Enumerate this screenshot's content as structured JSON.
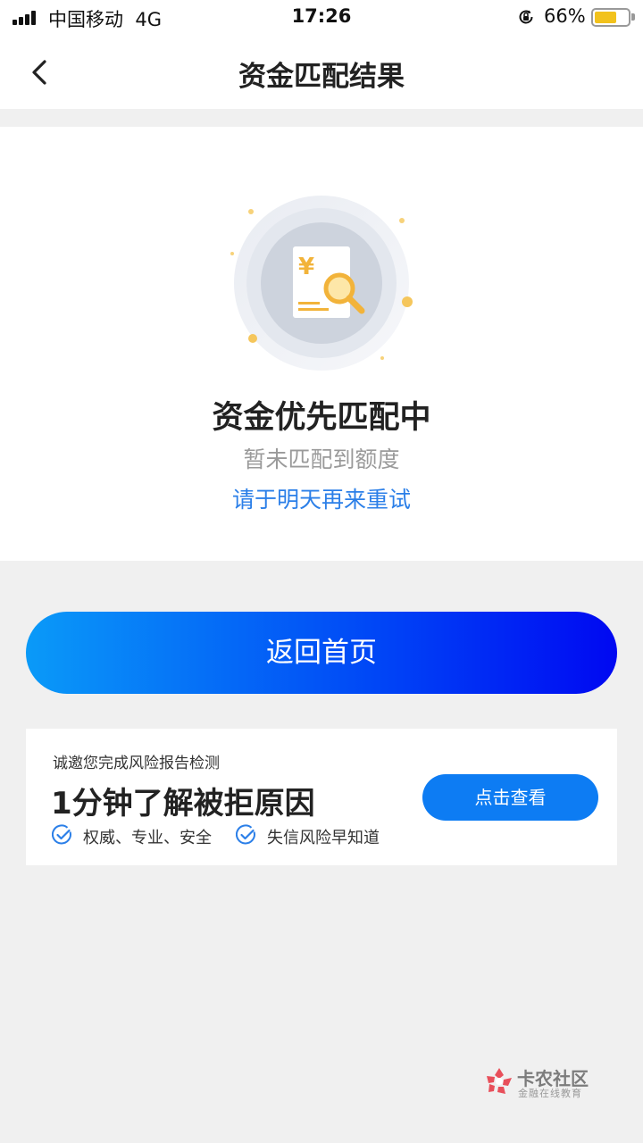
{
  "status_bar": {
    "carrier": "中国移动",
    "network": "4G",
    "time": "17:26",
    "battery_percent": "66%",
    "battery_level": 0.66,
    "signal_bars": 4
  },
  "nav": {
    "title": "资金匹配结果",
    "back_icon": "chevron-left-icon"
  },
  "result": {
    "illustration_icon": "yuan-document-magnifier-icon",
    "title": "资金优先匹配中",
    "subtitle": "暂未匹配到额度",
    "hint": "请于明天再来重试"
  },
  "actions": {
    "home_label": "返回首页"
  },
  "promo": {
    "invite": "诚邀您完成风险报告检测",
    "headline": "1分钟了解被拒原因",
    "features": [
      "权威、专业、安全",
      "失信风险早知道"
    ],
    "button_label": "点击查看"
  },
  "watermark": {
    "name": "卡农社区",
    "slogan": "金融在线教育"
  },
  "colors": {
    "accent": "#2b7fe8",
    "button_gradient_start": "#0a9af8",
    "button_gradient_end": "#0008f2",
    "promo_button": "#0d7cf3",
    "battery": "#f2c21c",
    "page_background": "#f0f0f0"
  }
}
